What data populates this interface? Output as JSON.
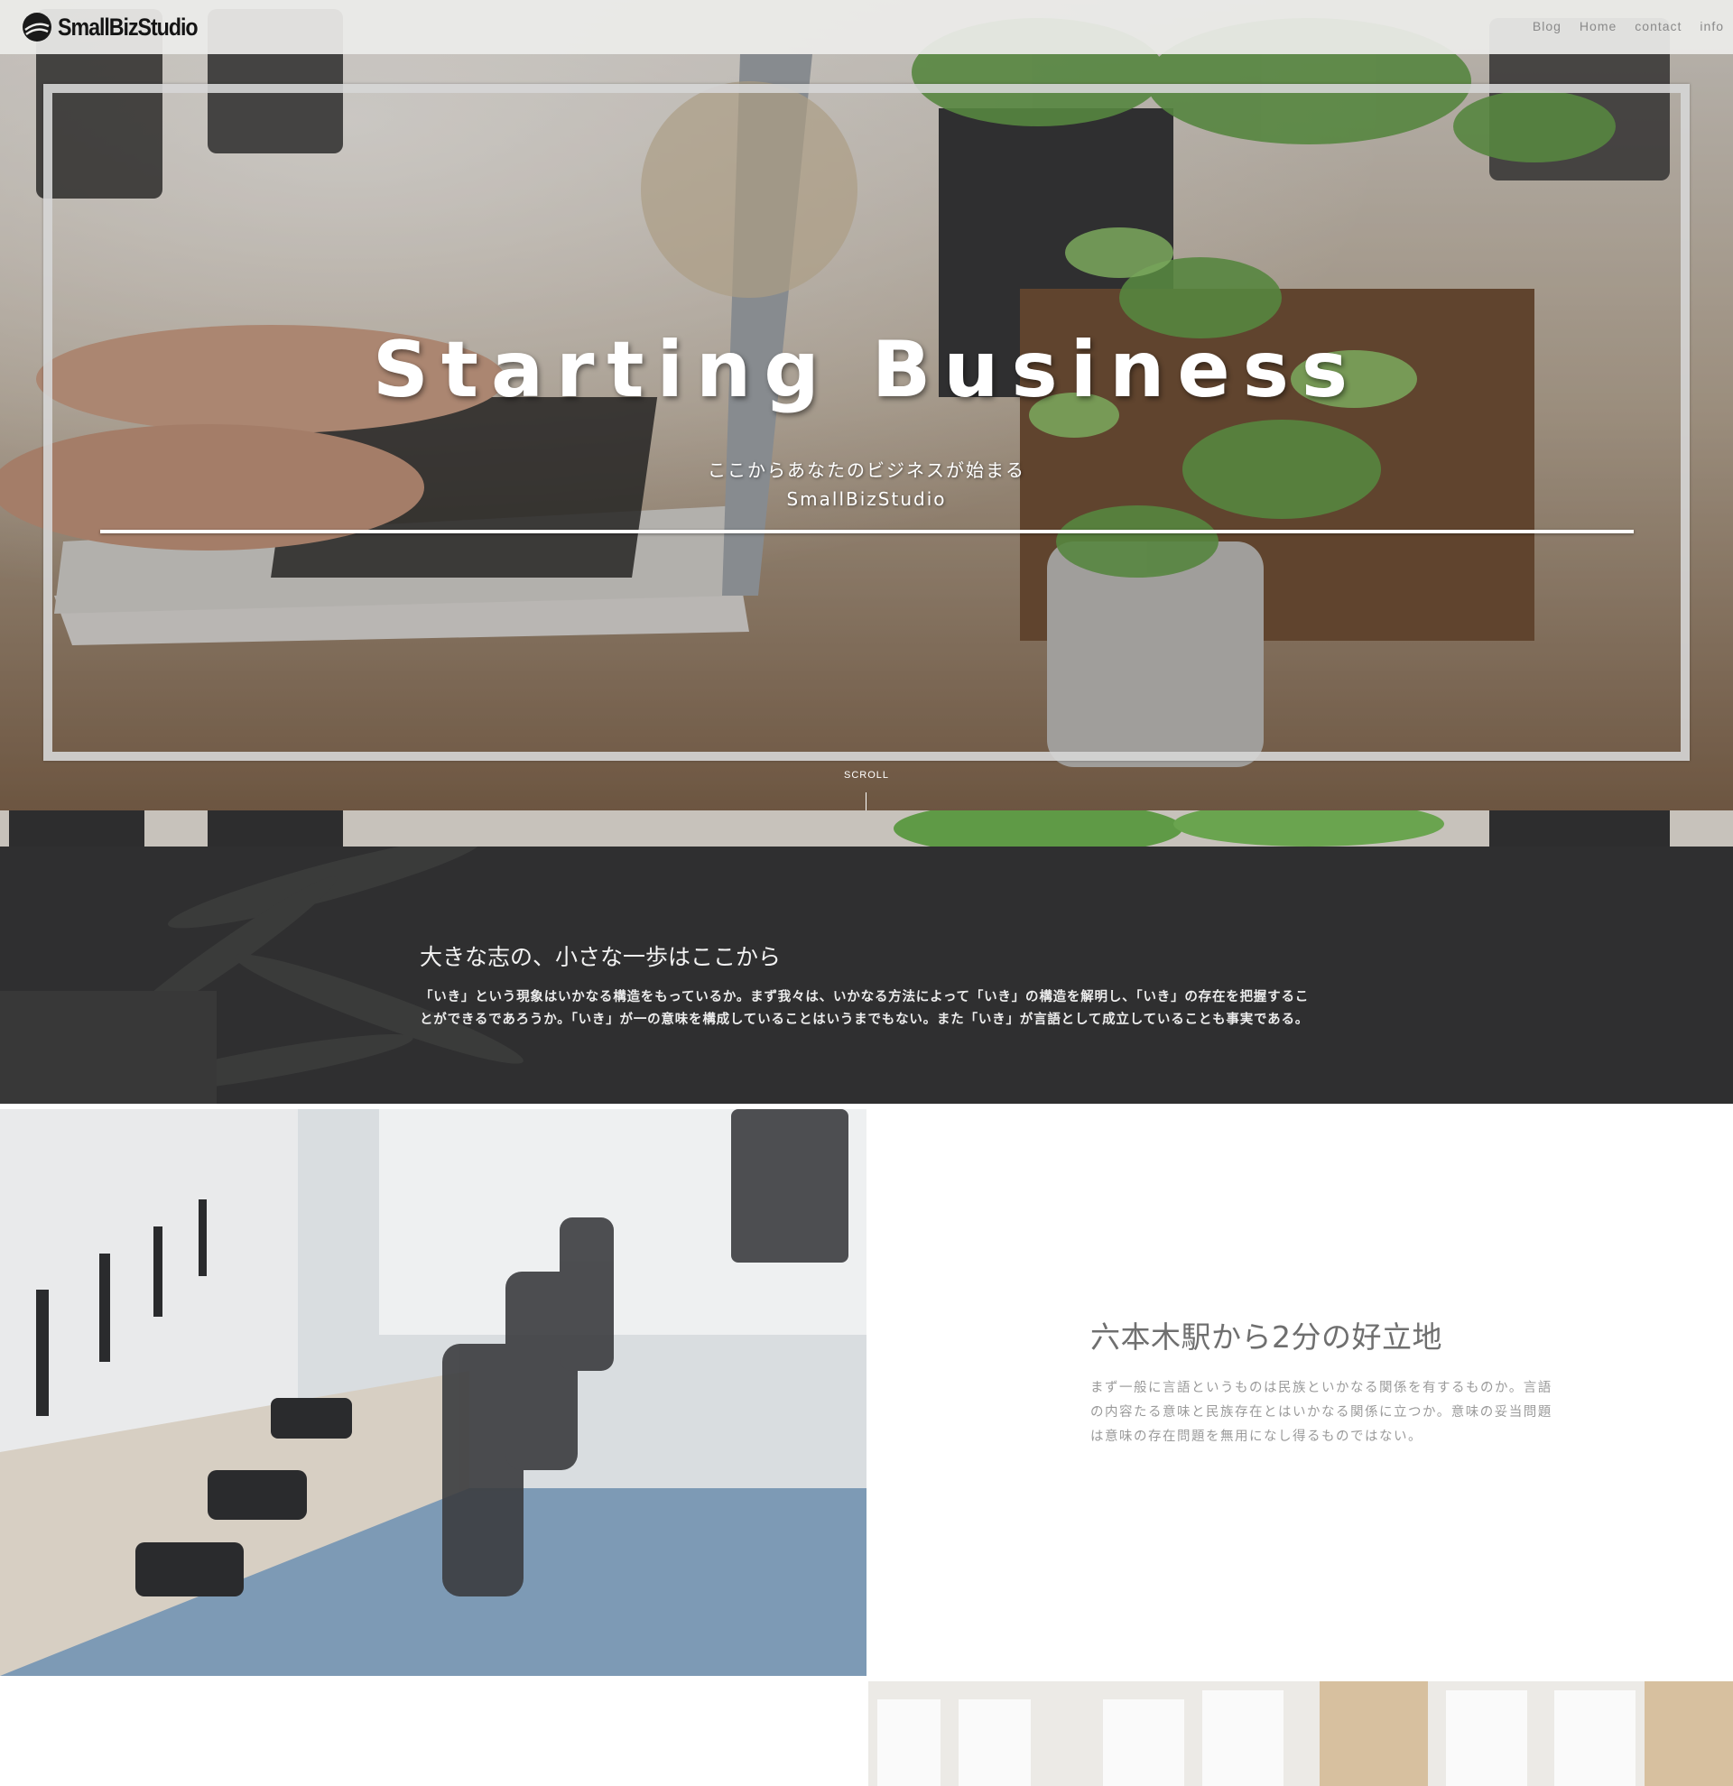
{
  "site": {
    "brand": "SmallBizStudio"
  },
  "nav": {
    "items": [
      "Blog",
      "Home",
      "contact",
      "info"
    ]
  },
  "hero": {
    "title": "Starting Business",
    "subtitle": "ここからあなたのビジネスが始まる",
    "subtitle2": "SmallBizStudio",
    "scroll_label": "SCROLL"
  },
  "intro": {
    "heading": "大きな志の、小さな一歩はここから",
    "body": "「いき」という現象はいかなる構造をもっているか。まず我々は、いかなる方法によって「いき」の構造を解明し、「いき」の存在を把握することができるであろうか。「いき」が一の意味を構成していることはいうまでもない。また「いき」が言語として成立していることも事実である。"
  },
  "feature": {
    "heading": "六本木駅から2分の好立地",
    "body": "まず一般に言語というものは民族といかなる関係を有するものか。言語の内容たる意味と民族存在とはいかなる関係に立つか。意味の妥当問題は意味の存在問題を無用になし得るものではない。"
  },
  "colors": {
    "dark_band": "#2f2f30",
    "header_bg": "#ececea",
    "text_gray": "#9a9a9a"
  }
}
